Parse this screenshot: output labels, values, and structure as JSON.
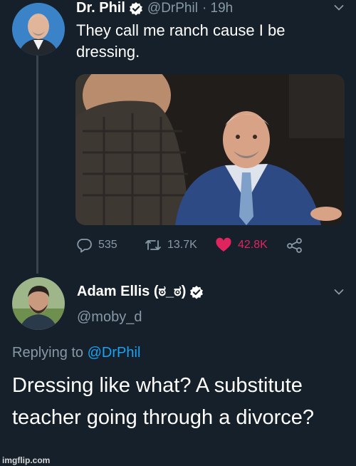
{
  "tweet": {
    "author_name": "Dr. Phil",
    "author_handle": "@DrPhil",
    "timestamp": "· 19h",
    "text": "They call me ranch cause I be dressing.",
    "actions": {
      "replies": "535",
      "retweets": "13.7K",
      "likes": "42.8K"
    }
  },
  "reply": {
    "author_name": "Adam Ellis (ಠ_ಠ)",
    "author_handle": "@moby_d",
    "replying_to_label": "Replying to",
    "replying_to_handle": "@DrPhil",
    "text": "Dressing like what? A substitute teacher going through a divorce?"
  },
  "icons": {
    "verified": "verified-badge-icon",
    "chevron": "chevron-down-icon",
    "reply": "reply-icon",
    "retweet": "retweet-icon",
    "like": "heart-icon",
    "share": "share-icon"
  },
  "colors": {
    "background": "#15202b",
    "secondary_text": "#8899a6",
    "link": "#1da1f2",
    "like": "#e0245e"
  },
  "watermark": "imgflip.com"
}
